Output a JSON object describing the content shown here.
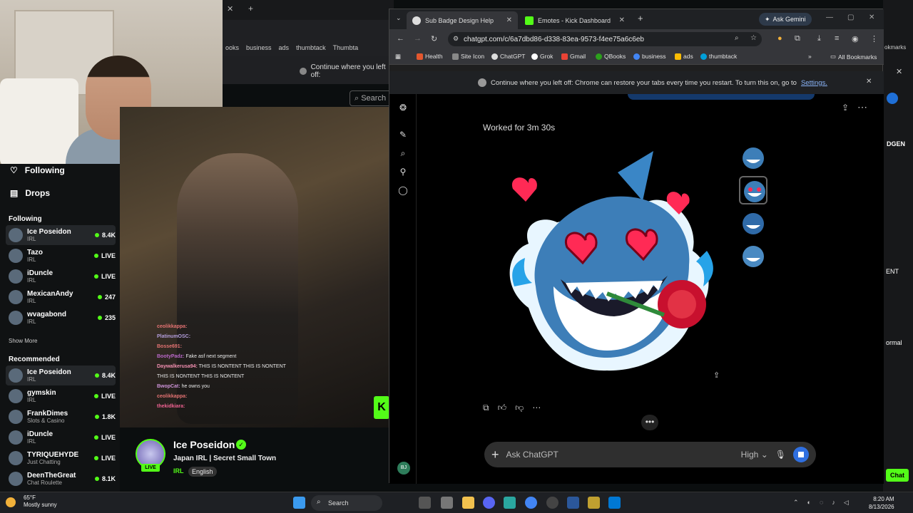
{
  "background_page": {
    "bookmarks": [
      "ooks",
      "business",
      "ads",
      "thumbtack",
      "Thumbta"
    ],
    "restore_text": "Continue where you left off:",
    "search_label": "Search",
    "nav": {
      "following": "Following",
      "drops": "Drops"
    },
    "following_header": "Following",
    "following": [
      {
        "name": "Ice Poseidon",
        "category": "IRL",
        "status": "8.4K",
        "selected": true
      },
      {
        "name": "Tazo",
        "category": "IRL",
        "status": "LIVE"
      },
      {
        "name": "iDuncle",
        "category": "IRL",
        "status": "LIVE"
      },
      {
        "name": "MexicanAndy",
        "category": "IRL",
        "status": "247"
      },
      {
        "name": "wvagabond",
        "category": "IRL",
        "status": "235"
      }
    ],
    "show_more": "Show More",
    "recommended_header": "Recommended",
    "recommended": [
      {
        "name": "Ice Poseidon",
        "category": "IRL",
        "status": "8.4K",
        "selected": true
      },
      {
        "name": "gymskin",
        "category": "IRL",
        "status": "LIVE"
      },
      {
        "name": "FrankDimes",
        "category": "Slots & Casino",
        "status": "1.8K"
      },
      {
        "name": "iDuncle",
        "category": "IRL",
        "status": "LIVE"
      },
      {
        "name": "TYRIQUEHYDE",
        "category": "Just Chatting",
        "status": "LIVE"
      },
      {
        "name": "DeenTheGreat",
        "category": "Chat Roulette",
        "status": "8.1K"
      }
    ],
    "chat": [
      {
        "user": "ceolikkappa:",
        "msg": "",
        "color": "#e57373"
      },
      {
        "user": "PlatinumOSC:",
        "msg": "",
        "color": "#b39ddb"
      },
      {
        "user": "Bosse691:",
        "msg": "",
        "color": "#e57373"
      },
      {
        "user": "BootyPadz:",
        "msg": "Fake asf next segment",
        "color": "#ba68c8"
      },
      {
        "user": "Daywalkerusa94:",
        "msg": "THIS IS NONTENT  THIS IS NONTENT",
        "color": "#f48fb1"
      },
      {
        "user": "",
        "msg": "THIS IS NONTENT   THIS IS NONTENT",
        "color": "#f48fb1"
      },
      {
        "user": "BwopCat:",
        "msg": "he owns you",
        "color": "#ce93d8"
      },
      {
        "user": "ceolikkappa:",
        "msg": "",
        "color": "#e57373"
      },
      {
        "user": "thekidkiara:",
        "msg": "",
        "color": "#f06292"
      }
    ],
    "stream": {
      "name": "Ice Poseidon",
      "live": "LIVE",
      "title": "Japan IRL | Secret Small Town",
      "category": "IRL",
      "language": "English"
    },
    "right_fragments": [
      "okmarks",
      "DGEN",
      "ENT",
      "ormal",
      "Chat"
    ]
  },
  "browser": {
    "tabs": [
      {
        "label": "Sub Badge Design Help",
        "active": true
      },
      {
        "label": "Emotes - Kick Dashboard",
        "active": false
      }
    ],
    "new_tab": "+",
    "ask_gemini": "Ask Gemini",
    "url": "chatgpt.com/c/6a7dbd86-d338-83ea-9573-f4ee75a6c6eb",
    "bookmarks": [
      "Health",
      "Site Icon",
      "ChatGPT",
      "Grok",
      "Gmail",
      "QBooks",
      "business",
      "ads",
      "thumbtack"
    ],
    "all_bookmarks": "All Bookmarks",
    "restore_text": "Continue where you left off: Chrome can restore your tabs every time you restart. To turn this on, go to",
    "restore_link": "Settings."
  },
  "chatgpt": {
    "worked_for": "Worked for 3m 30s",
    "composer_placeholder": "Ask ChatGPT",
    "model_effort": "High",
    "avatar_initials": "BJ",
    "more_label": "•••",
    "accent": "#2f6fe0"
  },
  "taskbar": {
    "weather_temp": "65°F",
    "weather_desc": "Mostly sunny",
    "search": "Search",
    "time": "8:20 AM",
    "date": "8/13/2026"
  }
}
